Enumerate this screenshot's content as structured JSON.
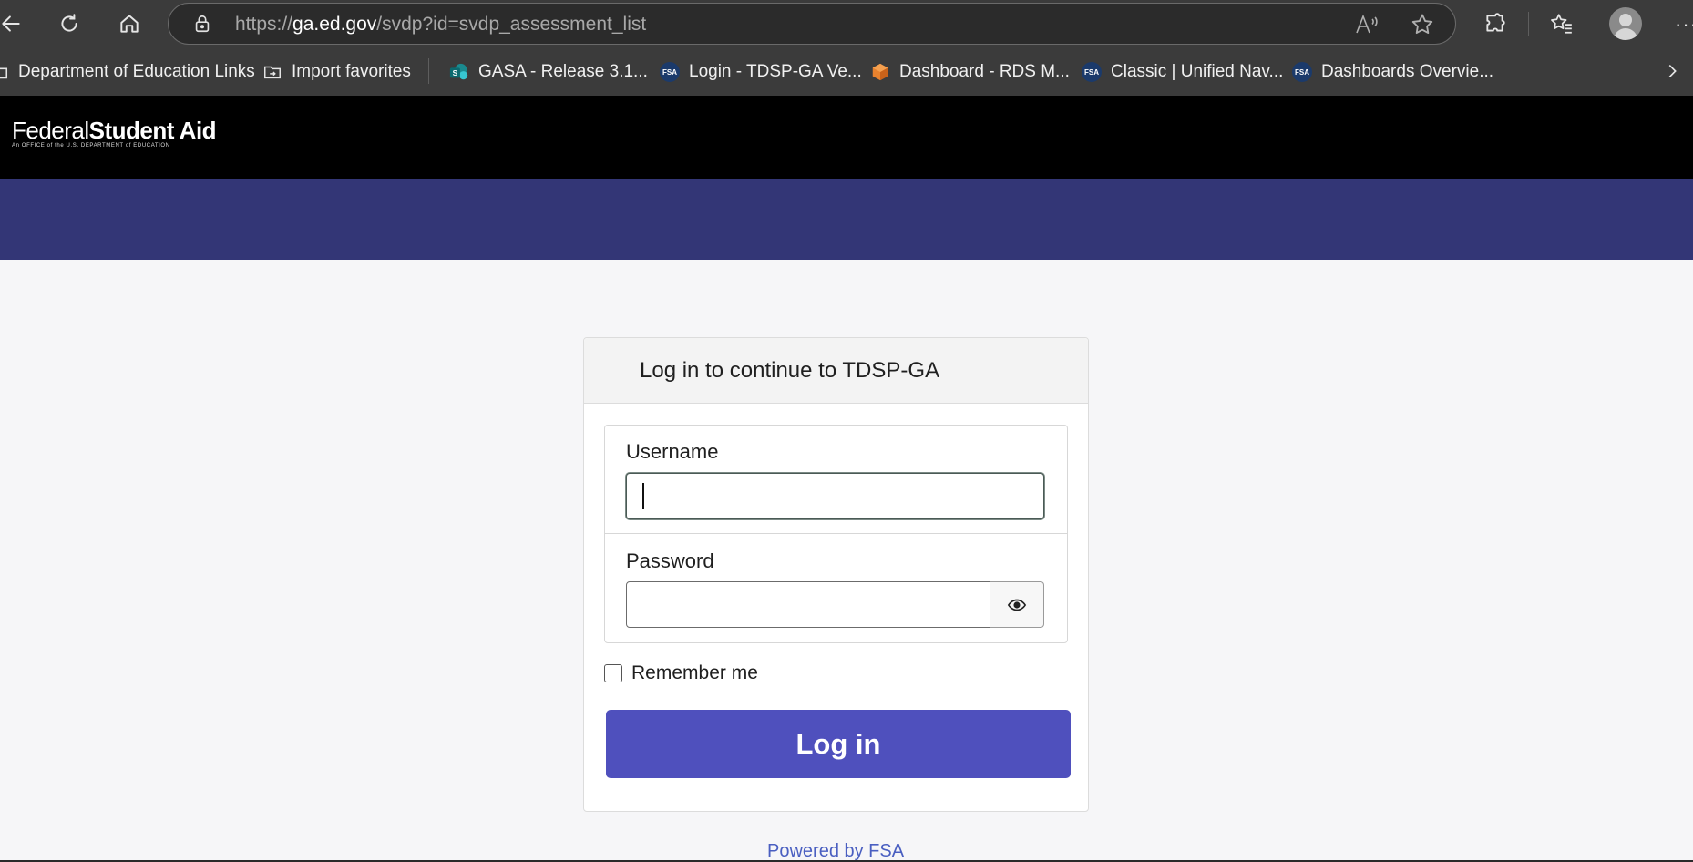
{
  "browser": {
    "url_prefix": "https://",
    "url_host": "ga.ed.gov",
    "url_path": "/svdp?id=svdp_assessment_list",
    "icons": {
      "back": "back-arrow-icon",
      "refresh": "refresh-icon",
      "home": "home-icon",
      "lock": "lock-icon",
      "read_aloud": "read-aloud-icon",
      "favorite": "star-icon",
      "extensions": "puzzle-icon",
      "favorites_bar": "favorites-icon",
      "profile": "profile-avatar-icon",
      "more": "more-icon"
    },
    "more_label": "···",
    "bookmarks": [
      {
        "label": "Department of Education Links",
        "icon": "folder-icon"
      },
      {
        "label": "Import favorites",
        "icon": "import-folder-icon"
      },
      {
        "label": "GASA - Release 3.1...",
        "icon": "sharepoint-icon"
      },
      {
        "label": "Login - TDSP-GA Ve...",
        "icon": "fsa-icon"
      },
      {
        "label": "Dashboard - RDS M...",
        "icon": "aws-cube-icon"
      },
      {
        "label": "Classic | Unified Nav...",
        "icon": "fsa-icon"
      },
      {
        "label": "Dashboards Overvie...",
        "icon": "fsa-icon"
      }
    ],
    "fsa_badge": "FSA",
    "sp_badge": "S"
  },
  "site": {
    "logo_regular": "Federal",
    "logo_bold": "Student Aid",
    "logo_tagline": "An OFFICE of the U.S. DEPARTMENT of EDUCATION",
    "header_color": "#000000",
    "banner_color": "#333676"
  },
  "login": {
    "title": "Log in to continue to TDSP-GA",
    "username_label": "Username",
    "username_value": "",
    "password_label": "Password",
    "password_value": "",
    "show_password_icon": "eye-icon",
    "remember_label": "Remember me",
    "remember_checked": false,
    "submit_label": "Log in",
    "button_color": "#4f50bd"
  },
  "footer": {
    "powered_by": "Powered by FSA"
  }
}
